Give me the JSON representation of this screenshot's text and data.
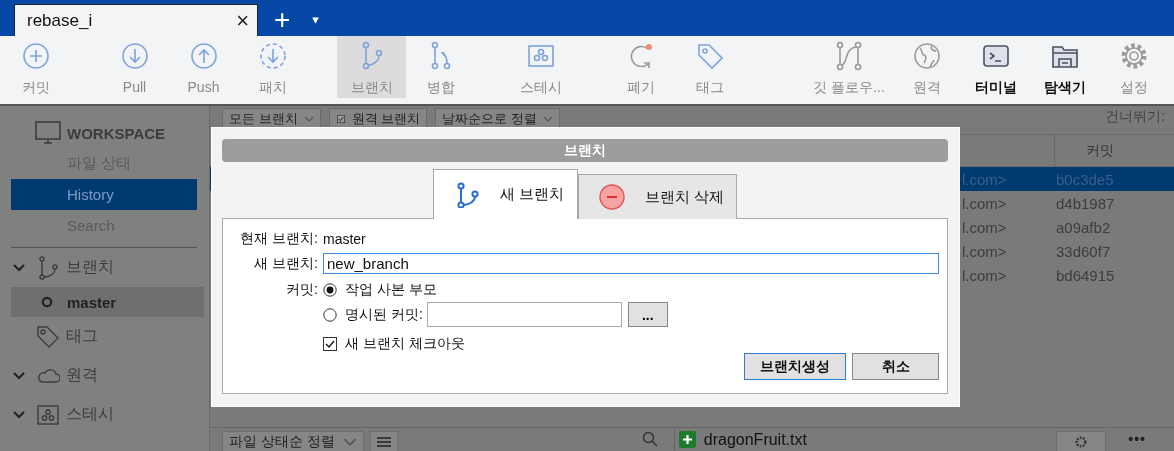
{
  "tab_bar": {
    "tabs": [
      {
        "label": "rebase_i",
        "selected": true,
        "close": "×"
      }
    ],
    "new_tab": "+",
    "menu": "▾"
  },
  "toolbar": {
    "items": [
      {
        "label": "커밋",
        "selected": false,
        "kind": "normal"
      },
      {
        "label": "Pull",
        "selected": false,
        "kind": "normal"
      },
      {
        "label": "Push",
        "selected": false,
        "kind": "normal"
      },
      {
        "label": "패치",
        "selected": false,
        "kind": "normal"
      },
      {
        "label": "브랜치",
        "selected": true,
        "kind": "normal"
      },
      {
        "label": "병합",
        "selected": false,
        "kind": "normal"
      },
      {
        "label": "스테시",
        "selected": false,
        "kind": "normal"
      },
      {
        "label": "폐기",
        "selected": false,
        "kind": "normal"
      },
      {
        "label": "태그",
        "selected": false,
        "kind": "normal"
      },
      {
        "label": "깃 플로우...",
        "selected": false,
        "kind": "normal"
      },
      {
        "label": "원격",
        "selected": false,
        "kind": "normal"
      },
      {
        "label": "터미널",
        "selected": false,
        "kind": "strong"
      },
      {
        "label": "탐색기",
        "selected": false,
        "kind": "strong"
      },
      {
        "label": "설정",
        "selected": false,
        "kind": "normal"
      }
    ]
  },
  "sidebar": {
    "workspace": {
      "label": "WORKSPACE",
      "items": [
        {
          "label": "파일 상태",
          "selected": false
        },
        {
          "label": "History",
          "selected": true
        },
        {
          "label": "Search",
          "selected": false
        }
      ]
    },
    "sections": [
      {
        "label": "브랜치",
        "expanded": true,
        "children": [
          {
            "label": "master",
            "selected": true
          }
        ]
      },
      {
        "label": "태그"
      },
      {
        "label": "원격",
        "expanded": true
      },
      {
        "label": "스테시",
        "expanded": true
      }
    ]
  },
  "filters": [
    {
      "kind": "dropdown",
      "label": "모든 브랜치"
    },
    {
      "kind": "checkbox",
      "label": "원격 브랜치",
      "checked": true
    },
    {
      "kind": "dropdown",
      "label": "날짜순으로 정렬"
    }
  ],
  "skip_label": "건너뛰기:",
  "table": {
    "commit_column": "커밋",
    "rows": [
      {
        "column_1": "l.com>",
        "commit": "b0c3de5",
        "selected": true
      },
      {
        "column_1": "l.com>",
        "commit": "d4b1987",
        "selected": false
      },
      {
        "column_1": "l.com>",
        "commit": "a09afb2",
        "selected": false
      },
      {
        "column_1": "l.com>",
        "commit": "33d60f7",
        "selected": false
      },
      {
        "column_1": "l.com>",
        "commit": "bd64915",
        "selected": false
      }
    ]
  },
  "bottom_bar": {
    "sort": "파일 상태순 정렬",
    "file": "dragonFruit.txt",
    "more": "•••"
  },
  "dialog": {
    "title": "브랜치",
    "tabs": [
      {
        "kind": "new",
        "label": "새 브랜치",
        "selected": true
      },
      {
        "kind": "delete",
        "label": "브랜치 삭제",
        "selected": false
      }
    ],
    "current_branch_label": "현재 브랜치:",
    "current_branch": "master",
    "new_branch_label": "새 브랜치:",
    "new_branch_value": "new_branch",
    "commit_label": "커밋:",
    "options": [
      {
        "label": "작업 사본 부모",
        "selected": true,
        "kind": "plain"
      },
      {
        "label": "명시된 커밋:",
        "selected": false,
        "kind": "with_field"
      }
    ],
    "browse_button": "...",
    "checkout": {
      "label": "새 브랜치 체크아웃",
      "checked": true
    },
    "buttons": [
      {
        "label": "브랜치생성",
        "default": true
      },
      {
        "label": "취소",
        "default": false
      }
    ]
  }
}
